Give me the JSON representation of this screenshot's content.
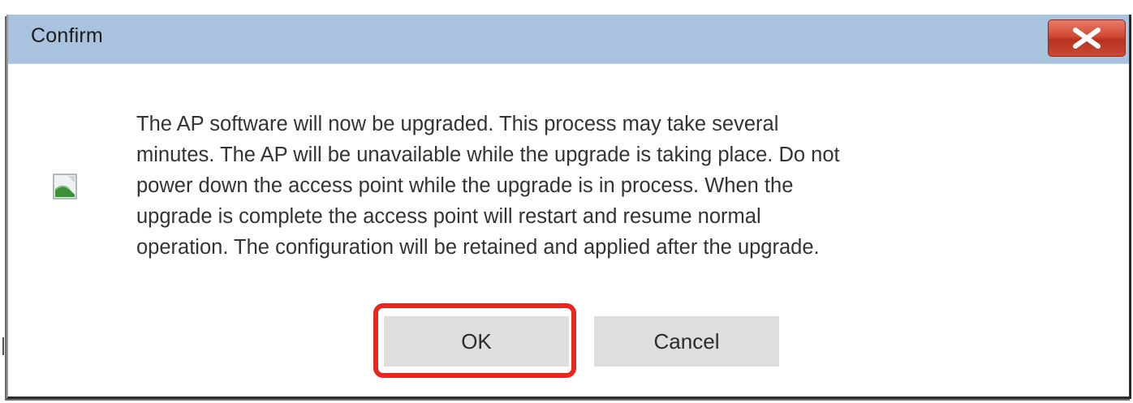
{
  "dialog": {
    "title": "Confirm",
    "close_icon": "close-x-icon",
    "message_icon": "broken-image-icon",
    "message_lines": [
      "The AP software will now be upgraded. This process may take several",
      "minutes. The AP will be unavailable while the upgrade is taking place. Do not",
      "power down the access point while the upgrade is in process. When the",
      "upgrade is complete the access point will restart and resume normal",
      "operation. The configuration will be retained and applied after the upgrade."
    ],
    "ok_label": "OK",
    "cancel_label": "Cancel"
  },
  "colors": {
    "titlebar": "#a9c3df",
    "close_button": "#c94a36",
    "button_bg": "#dedede",
    "highlight": "#e8281e"
  }
}
